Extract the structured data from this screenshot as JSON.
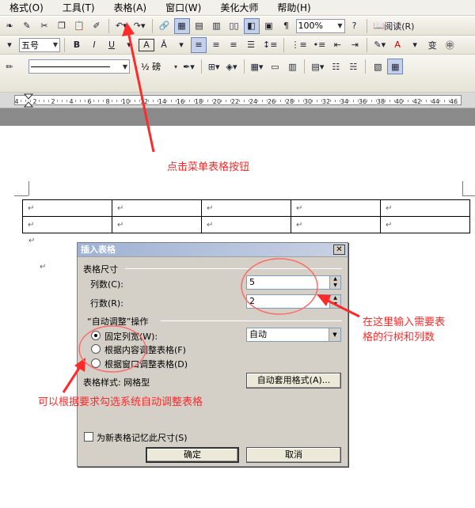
{
  "menubar": {
    "items": [
      "格式(O)",
      "工具(T)",
      "表格(A)",
      "窗口(W)",
      "美化大师",
      "帮助(H)"
    ]
  },
  "toolbar_standard": {
    "zoom": "100%",
    "reading_label": "阅读(R)"
  },
  "toolbar_formatting": {
    "font_size": "五号",
    "bold": "B",
    "italic": "I",
    "underline": "U",
    "char_border": "A",
    "font_color": "A"
  },
  "toolbar_tables": {
    "line_weight": "½ 磅"
  },
  "ruler": {
    "labels": [
      "4",
      "2",
      "2",
      "4",
      "6",
      "8",
      "10",
      "12",
      "14",
      "16",
      "18",
      "20",
      "22",
      "24",
      "26",
      "28",
      "30",
      "32",
      "34",
      "36",
      "38",
      "40",
      "42",
      "44",
      "46"
    ]
  },
  "document": {
    "para_mark": "↵"
  },
  "dialog": {
    "title": "插入表格",
    "size_group": "表格尺寸",
    "columns_label": "列数(C):",
    "columns_value": "5",
    "rows_label": "行数(R):",
    "rows_value": "2",
    "autofit_group": "“自动调整”操作",
    "fixed_width_label": "固定列宽(W):",
    "fixed_width_value": "自动",
    "fit_content_label": "根据内容调整表格(F)",
    "fit_window_label": "根据窗口调整表格(D)",
    "style_label": "表格样式: 网格型",
    "autoformat_button": "自动套用格式(A)...",
    "remember_label": "为新表格记忆此尺寸(S)",
    "ok_button": "确定",
    "cancel_button": "取消",
    "close_glyph": "✕"
  },
  "annotations": {
    "menu_hint": "点击菜单表格按钮",
    "size_hint_1": "在这里输入需要表",
    "size_hint_2": "格的行树和列数",
    "autofit_hint": "可以根据要求勾选系统自动调整表格",
    "color": "#ff2a2a"
  }
}
